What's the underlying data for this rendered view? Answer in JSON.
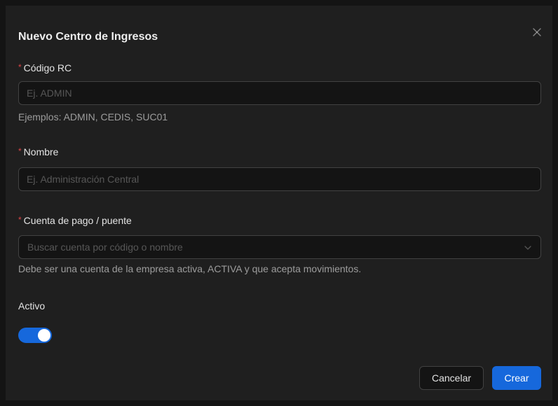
{
  "modal": {
    "title": "Nuevo Centro de Ingresos",
    "close_icon": "close-icon"
  },
  "fields": {
    "codigo": {
      "required_mark": "*",
      "label": "Código RC",
      "placeholder": "Ej. ADMIN",
      "value": "",
      "help": "Ejemplos: ADMIN, CEDIS, SUC01"
    },
    "nombre": {
      "required_mark": "*",
      "label": "Nombre",
      "placeholder": "Ej. Administración Central",
      "value": ""
    },
    "cuenta": {
      "required_mark": "*",
      "label": "Cuenta de pago / puente",
      "placeholder": "Buscar cuenta por código o nombre",
      "icon": "chevron-down-icon",
      "help": "Debe ser una cuenta de la empresa activa, ACTIVA y que acepta movimientos."
    },
    "activo": {
      "label": "Activo",
      "checked": true
    }
  },
  "footer": {
    "cancel_label": "Cancelar",
    "create_label": "Crear"
  },
  "colors": {
    "primary": "#1668dc",
    "required": "#dc4446",
    "modal_bg": "#1f1f1f",
    "input_bg": "#141414",
    "border": "#424242"
  }
}
